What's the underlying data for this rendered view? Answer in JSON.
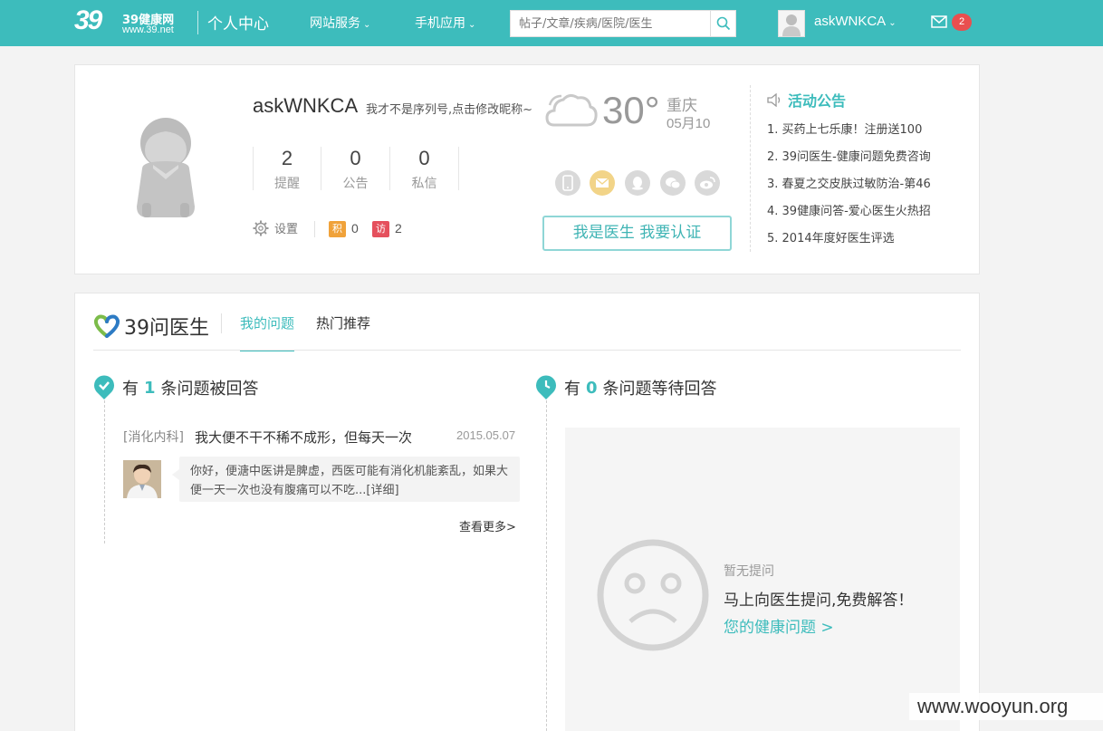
{
  "header": {
    "logo_num": "39",
    "logo_name": "39健康网",
    "logo_url": "www.39.net",
    "center_title": "个人中心",
    "nav": [
      {
        "label": "网站服务"
      },
      {
        "label": "手机应用"
      }
    ],
    "search_placeholder": "帖子/文章/疾病/医院/医生",
    "username": "askWNKCA",
    "mail_count": "2"
  },
  "profile": {
    "name": "askWNKCA",
    "tip": "我才不是序列号,点击修改昵称~",
    "stats": [
      {
        "num": "2",
        "label": "提醒"
      },
      {
        "num": "0",
        "label": "公告"
      },
      {
        "num": "0",
        "label": "私信"
      }
    ],
    "settings_label": "设置",
    "points_tag": "积",
    "points_value": "0",
    "visits_tag": "访",
    "visits_value": "2",
    "tag_colors": {
      "points": "#f0a23a",
      "visits": "#e5505d"
    }
  },
  "weather": {
    "temp": "30°",
    "city": "重庆",
    "date": "05月10"
  },
  "doctor_button": "我是医生 我要认证",
  "announcements": {
    "title": "活动公告",
    "items": [
      "1. 买药上七乐康！注册送100",
      "2. 39问医生-健康问题免费咨询",
      "3. 春夏之交皮肤过敏防治-第46",
      "4. 39健康问答-爱心医生火热招",
      "5. 2014年度好医生评选"
    ]
  },
  "questions": {
    "logo_text": "39问医生",
    "tabs": [
      {
        "label": "我的问题"
      },
      {
        "label": "热门推荐"
      }
    ],
    "answered": {
      "prefix": "有",
      "count": "1",
      "suffix": "条问题被回答",
      "item": {
        "category": "[消化内科]",
        "title": "我大便不干不稀不成形，但每天一次",
        "date": "2015.05.07",
        "reply": "你好，便溏中医讲是脾虚，西医可能有消化机能紊乱，如果大便一天一次也没有腹痛可以不吃...[详细]"
      },
      "more": "查看更多>"
    },
    "waiting": {
      "prefix": "有",
      "count": "0",
      "suffix": "条问题等待回答",
      "empty_1": "暂无提问",
      "empty_2": "马上向医生提问,免费解答！",
      "empty_link": "您的健康问题 >"
    }
  },
  "watermark": "www.wooyun.org",
  "colors": {
    "accent": "#3dbcbc",
    "badge": "#e94f4f"
  }
}
